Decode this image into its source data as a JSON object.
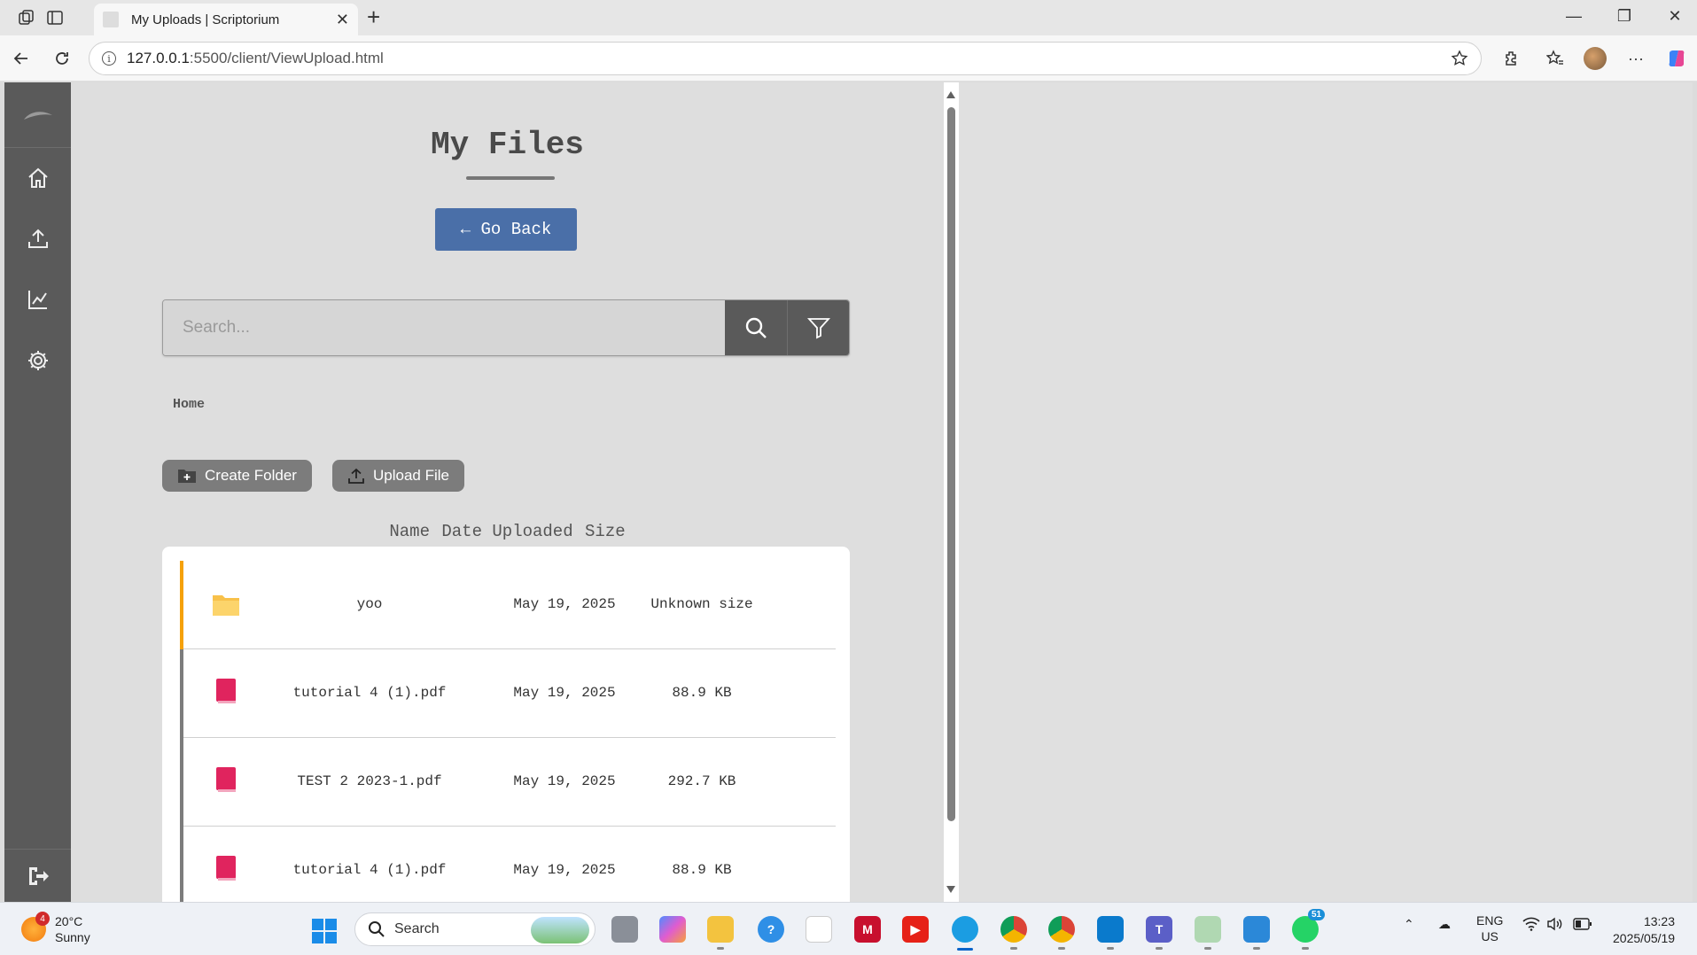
{
  "browser": {
    "tab_title": "My Uploads | Scriptorium",
    "url_host": "127.0.0.1",
    "url_path": ":5500/client/ViewUpload.html"
  },
  "page": {
    "title": "My Files",
    "go_back_label": "← Go Back",
    "search_placeholder": "Search...",
    "breadcrumb": "Home",
    "create_folder_label": "Create Folder",
    "upload_file_label": "Upload File",
    "columns": {
      "name": "Name",
      "date": "Date Uploaded",
      "size": "Size"
    },
    "files": [
      {
        "type": "folder",
        "name": "yoo",
        "date": "May 19, 2025",
        "size": "Unknown size"
      },
      {
        "type": "pdf",
        "name": "tutorial 4 (1).pdf",
        "date": "May 19, 2025",
        "size": "88.9 KB"
      },
      {
        "type": "pdf",
        "name": "TEST 2 2023-1.pdf",
        "date": "May 19, 2025",
        "size": "292.7 KB"
      },
      {
        "type": "pdf",
        "name": "tutorial 4 (1).pdf",
        "date": "May 19, 2025",
        "size": "88.9 KB"
      }
    ]
  },
  "colors": {
    "accent_button": "#4a6fa8",
    "folder_marker": "#f5a10a",
    "sidebar": "#5a5a5a"
  },
  "taskbar": {
    "weather_temp": "20°C",
    "weather_desc": "Sunny",
    "weather_badge": "4",
    "search_label": "Search",
    "lang_top": "ENG",
    "lang_bottom": "US",
    "time": "13:23",
    "date": "2025/05/19",
    "whatsapp_badge": "51"
  }
}
